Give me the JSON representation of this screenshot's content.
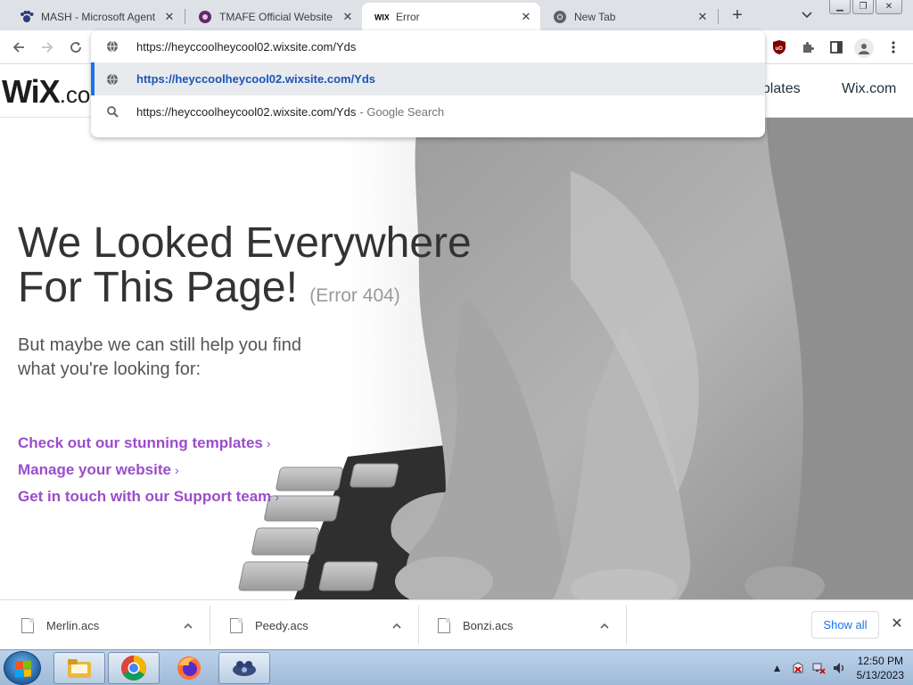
{
  "browser": {
    "tabs": [
      {
        "title": "MASH - Microsoft Agent",
        "favicon": "paw-icon",
        "active": false
      },
      {
        "title": "TMAFE Official Website",
        "favicon": "tmafe-icon",
        "active": false
      },
      {
        "title": "Error",
        "favicon": "wix-icon",
        "active": true
      },
      {
        "title": "New Tab",
        "favicon": "chrome-icon",
        "active": false
      }
    ],
    "new_tab": "+",
    "omnibox": {
      "value": "https://heyccoolheycool02.wixsite.com/Yds",
      "suggestions": [
        {
          "text": "https://heyccoolheycool02.wixsite.com/Yds",
          "hint": "",
          "icon": "globe-icon"
        },
        {
          "text": "https://heyccoolheycool02.wixsite.com/Yds",
          "hint": "- Google Search",
          "icon": "search-icon"
        }
      ]
    },
    "extensions": {
      "ublock": "uO"
    }
  },
  "page": {
    "logo": {
      "main": "WiX",
      "tail": ".co"
    },
    "nav": {
      "templates": "nplates",
      "wix": "Wix.com"
    },
    "headline_line1": "We Looked Everywhere",
    "headline_line2": "For This Page!",
    "error_code": "(Error 404)",
    "subtitle": "But maybe we can still help you find what you're looking for:",
    "links": [
      "Check out our stunning templates",
      "Manage your website",
      "Get in touch with our Support team"
    ],
    "link_chevron": "›",
    "link_color": "#9b4dca"
  },
  "downloads": {
    "items": [
      "Merlin.acs",
      "Peedy.acs",
      "Bonzi.acs"
    ],
    "show_all": "Show all"
  },
  "taskbar": {
    "time": "12:50 PM",
    "date": "5/13/2023"
  }
}
